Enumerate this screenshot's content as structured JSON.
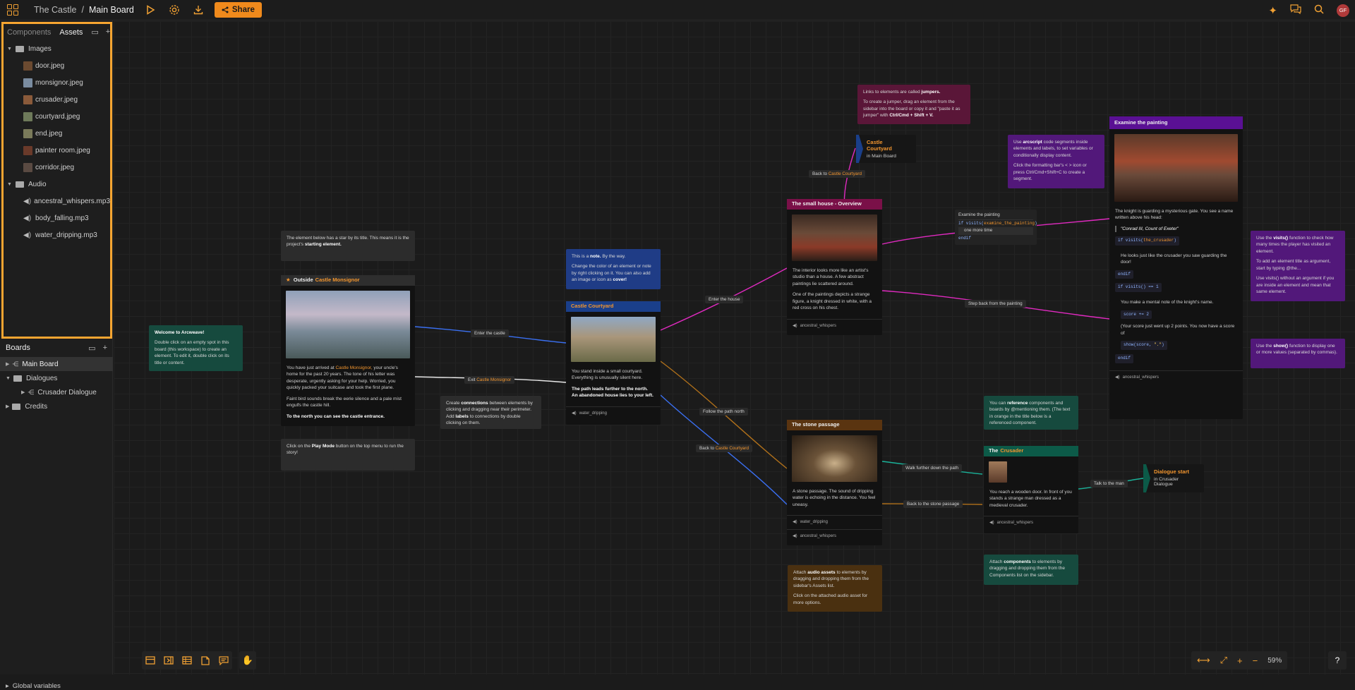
{
  "header": {
    "project": "The Castle",
    "separator": "/",
    "board": "Main Board",
    "share_label": "Share",
    "avatar_initials": "GF"
  },
  "sidebar": {
    "tabs": [
      "Components",
      "Assets"
    ],
    "assets": {
      "images_folder": "Images",
      "images": [
        "door.jpeg",
        "monsignor.jpeg",
        "crusader.jpeg",
        "courtyard.jpeg",
        "end.jpeg",
        "painter room.jpeg",
        "corridor.jpeg"
      ],
      "audio_folder": "Audio",
      "audio": [
        "ancestral_whispers.mp3",
        "body_falling.mp3",
        "water_dripping.mp3"
      ]
    },
    "boards_title": "Boards",
    "boards": [
      "Main Board",
      "Dialogues",
      "Crusader Dialogue",
      "Credits"
    ],
    "global_variables": "Global variables"
  },
  "canvas": {
    "notes": {
      "welcome_title": "Welcome to Arcweave!",
      "welcome_body": "Double click on an empty spot in this board (this workspace) to create an element. To edit it, double click on its title or content.",
      "starting_a": "The element below has a star by its title. This means it is the project's",
      "starting_b": "starting element.",
      "play_a": "Click on the",
      "play_b": "Play Mode",
      "play_c": "button on the top menu to run the story!",
      "note_a": "This is a",
      "note_b": "note.",
      "note_c": "By the way.",
      "note_d": "Change the color of an element or note by right clicking on it. You can also add an image or icon as",
      "note_e": "cover!",
      "conn_a": "Create",
      "conn_b": "connections",
      "conn_c": "between elements by clicking and dragging near their perimeter. Add",
      "conn_d": "labels",
      "conn_e": "to connections by double clicking on them.",
      "jumper_a": "Links to elements are called",
      "jumper_b": "jumpers.",
      "jumper_c": "To create a jumper, drag an element from the sidebar into the board or copy it and \"paste it as jumper\" with",
      "jumper_d": "Ctrl/Cmd + Shift + V.",
      "arcscript_a": "Use",
      "arcscript_b": "arcscript",
      "arcscript_c": "code segments inside elements and labels, to set variables or conditionally display content.",
      "arcscript_d": "Click the formatting bar's < > icon or press Ctrl/Cmd+Shift+C to create a segment.",
      "visits_a": "Use the",
      "visits_b": "visits()",
      "visits_c": "function to check how many times the player has visited an element.",
      "visits_d": "To add an element title as argument, start by typing @the...",
      "visits_e": "Use visits() without an argument if you are inside an element and mean that same element.",
      "show_a": "Use the",
      "show_b": "show()",
      "show_c": "function to display one or more values (separated by commas).",
      "ref_a": "You can",
      "ref_b": "reference",
      "ref_c": "components and boards by @mentioning them. (The text in orange in the title below is a referenced component.",
      "audio_a": "Attach",
      "audio_b": "audio assets",
      "audio_c": "to elements by dragging and dropping them from the sidebar's Assets list.",
      "audio_d": "Click on the attached audio asset for more options.",
      "comp_a": "Attach",
      "comp_b": "components",
      "comp_c": "to elements by dragging and dropping them from the Components list on the sidebar."
    },
    "elements": {
      "outside_title": "Outside",
      "outside_ref": "Castle Monsignor",
      "outside_p1a": "You have just arrived at",
      "outside_p1b": "Castle Monsignor,",
      "outside_p1c": "your uncle's home for the past 20 years. The tone of his letter was desperate, urgently asking for your help. Worried, you quickly packed your suitcase and took the first plane.",
      "outside_p2": "Faint bird sounds break the eerie silence and a pale mist engulfs the castle hill.",
      "outside_p3": "To the north you can see the castle entrance.",
      "courtyard_title": "Castle Courtyard",
      "courtyard_p1": "You stand inside a small courtyard. Everything is unusually silent here.",
      "courtyard_p2": "The path leads further to the north. An abandoned house lies to your left.",
      "courtyard_audio": "water_dripping",
      "house_title": "The small house - Overview",
      "house_p1": "The interior looks more like an artist's studio than a house. A few abstract paintings lie scattered around.",
      "house_p2": "One of the paintings depicts a strange figure, a knight dressed in white, with a red cross on his chest.",
      "house_audio": "ancestral_whispers",
      "stone_title": "The stone passage",
      "stone_p1": "A stone passage. The sound of dripping water is echoing in the distance. You feel uneasy.",
      "stone_audio1": "water_dripping",
      "stone_audio2": "ancestral_whispers",
      "painting_title": "Examine the painting",
      "painting_p1": "The knight is guarding a mysterious gate. You see a name written above his head:",
      "painting_quote": "\"Conrad III, Count of Exeter\"",
      "painting_code1a": "if visits(",
      "painting_code1b": "the_crusader",
      "painting_code1c": ")",
      "painting_p2": "He looks just like the crusader you saw guarding the door!",
      "painting_endif": "endif",
      "painting_code2": "if visits() == 1",
      "painting_p3": "You make a mental note of the knight's name.",
      "painting_code3": "score += 2",
      "painting_p4": "(Your score just went up 2 points. You now have a score of",
      "painting_code4a": "show(score, ",
      "painting_code4b": "\".\"",
      "painting_code4c": ")",
      "painting_audio": "ancestral_whispers",
      "crusader_title": "The",
      "crusader_ref": "Crusader",
      "crusader_p1": "You reach a wooden door. In front of you stands a strange man dressed as a medieval crusader.",
      "crusader_audio": "ancestral_whispers"
    },
    "jumpers": {
      "courtyard_title": "Castle Courtyard",
      "courtyard_sub": "in Main Board",
      "dialogue_title": "Dialogue start",
      "dialogue_sub": "in Crusader Dialogue"
    },
    "labels": {
      "enter_castle": "Enter the castle",
      "exit_a": "Exit",
      "exit_b": "Castle Monsignor",
      "enter_house": "Enter the house",
      "follow_path": "Follow the path north",
      "back_to_a": "Back to",
      "back_to_b": "Castle Courtyard",
      "back_to2_a": "Back to",
      "back_to2_b": "Castle Courtyard",
      "examine": "Examine the painting",
      "examine_code_a": "if visits(",
      "examine_code_b": "examine_the_painting",
      "examine_code_c": ")",
      "one_more": "one more time",
      "examine_endif": "endif",
      "step_back": "Step back from the painting",
      "walk_further": "Walk further down the path",
      "back_stone": "Back to the stone passage",
      "talk_man": "Talk to the man"
    }
  },
  "zoom": "59%",
  "colors": {
    "accent": "#f0a033",
    "highlight_border": "#f7a531",
    "note_green": "#164a3e",
    "note_blue": "#1f3c86",
    "note_purple": "#52187a",
    "note_pink": "#5a1638",
    "note_brown": "#4a3010",
    "note_gray": "#2c2c2c",
    "header_magenta": "#7a1048",
    "header_purple": "#5a1094",
    "header_blue": "#1a3f8a",
    "header_teal": "#0c5a48",
    "header_brown": "#5a3410",
    "wire_blue": "#3a6ff0",
    "wire_magenta": "#e02ac0",
    "wire_orange": "#b0701a",
    "wire_teal": "#1ab39a"
  }
}
